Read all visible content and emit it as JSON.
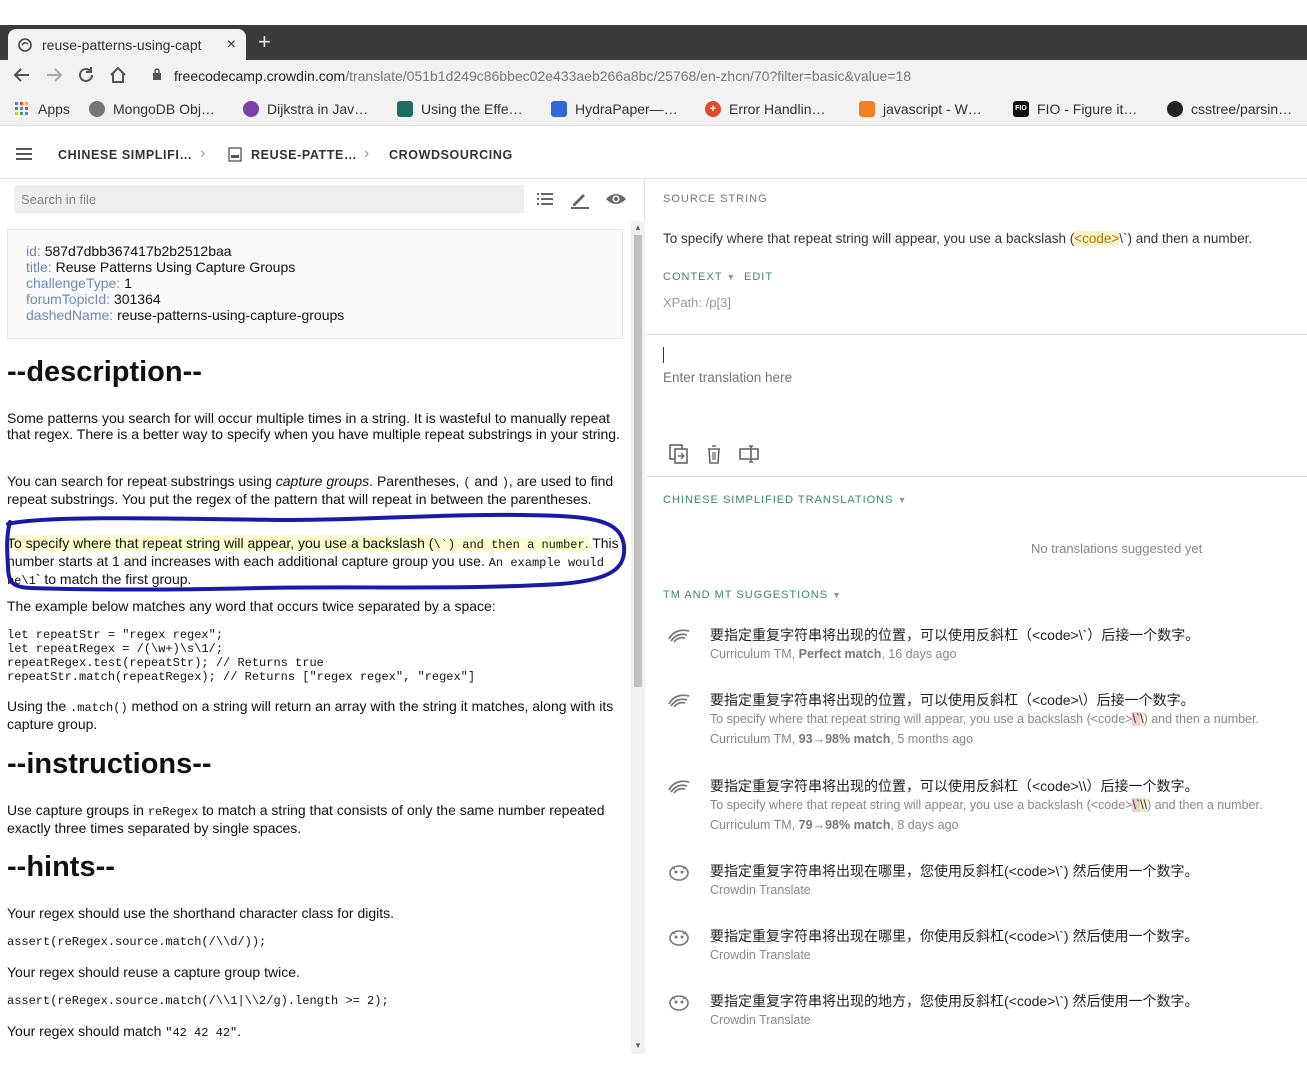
{
  "browser": {
    "tab_title": "reuse-patterns-using-capt",
    "tab_close": "×",
    "new_tab": "+",
    "url_host": "freecodecamp.crowdin.com",
    "url_path": "/translate/051b1d249c86bbec02e433aeb266a8bc/25768/en-zhcn/70?filter=basic&value=18",
    "bookmarks": [
      {
        "label": "Apps",
        "icon": "apps-grid-icon",
        "color": "#4285f4"
      },
      {
        "label": "MongoDB Obj…",
        "icon": "mongodb-icon",
        "color": "#777777"
      },
      {
        "label": "Dijkstra in Jav…",
        "icon": "dijkstra-icon",
        "color": "#7b3fa8"
      },
      {
        "label": "Using the Effe…",
        "icon": "react-icon",
        "color": "#1e6e63"
      },
      {
        "label": "HydraPaper—…",
        "icon": "hydrapaper-icon",
        "color": "#3367d6"
      },
      {
        "label": "Error Handlin…",
        "icon": "error-plus-icon",
        "color": "#e04b29"
      },
      {
        "label": "javascript - W…",
        "icon": "stackoverflow-icon",
        "color": "#f48024"
      },
      {
        "label": "FIO - Figure it…",
        "icon": "fio-icon",
        "color": "#111111"
      },
      {
        "label": "csstree/parsin…",
        "icon": "github-icon",
        "color": "#222222"
      }
    ]
  },
  "header": {
    "breadcrumbs": [
      "CHINESE SIMPLIFI…",
      "REUSE-PATTE…",
      "CROWDSOURCING"
    ]
  },
  "left": {
    "search_placeholder": "Search in file",
    "meta": [
      {
        "k": "id:",
        "v": "587d7dbb367417b2b2512baa"
      },
      {
        "k": "title:",
        "v": "Reuse Patterns Using Capture Groups"
      },
      {
        "k": "challengeType:",
        "v": "1"
      },
      {
        "k": "forumTopicId:",
        "v": "301364"
      },
      {
        "k": "dashedName:",
        "v": "reuse-patterns-using-capture-groups"
      }
    ],
    "h_description": "--description--",
    "p1": "Some patterns you search for will occur multiple times in a string. It is wasteful to manually repeat that regex. There is a better way to specify when you have multiple repeat substrings in your string.",
    "p2_a": "You can search for repeat substrings using ",
    "p2_em": "capture groups",
    "p2_b": ". Parentheses, ",
    "p2_c1": "(",
    "p2_c": " and ",
    "p2_c2": ")",
    "p2_d": ", are used to find repeat substrings. You put the regex of the pattern that will repeat in between the parentheses.",
    "p3_hl": "To specify where that repeat string will appear, you use a backslash (",
    "p3_code1": "\\`) and then a number",
    "p3_dot": ".",
    "p3_rest": " This number starts at 1 and increases with each additional capture group you use. ",
    "p3_code2": "An example would be\\1",
    "p3_end": "` to match the first group.",
    "p4": "The example below matches any word that occurs twice separated by a space:",
    "code_block": "let repeatStr = \"regex regex\";\nlet repeatRegex = /(\\w+)\\s\\1/;\nrepeatRegex.test(repeatStr); // Returns true\nrepeatStr.match(repeatRegex); // Returns [\"regex regex\", \"regex\"]",
    "p5_a": "Using the ",
    "p5_code": ".match()",
    "p5_b": " method on a string will return an array with the string it matches, along with its capture group.",
    "h_instructions": "--instructions--",
    "p6_a": "Use capture groups in ",
    "p6_code": "reRegex",
    "p6_b": " to match a string that consists of only the same number repeated exactly three times separated by single spaces.",
    "h_hints": "--hints--",
    "hint1": "Your regex should use the shorthand character class for digits.",
    "hint1_code": "assert(reRegex.source.match(/\\\\d/));",
    "hint2": "Your regex should reuse a capture group twice.",
    "hint2_code": "assert(reRegex.source.match(/\\\\1|\\\\2/g).length >= 2);",
    "hint3_a": "Your regex should match ",
    "hint3_code": "\"42 42 42\"",
    "hint3_b": "."
  },
  "right": {
    "source_label": "SOURCE STRING",
    "source_a": "To specify where that repeat string will appear, you use a backslash (",
    "source_tag": "<code>",
    "source_b": "\\`) and then a number.",
    "context_label": "CONTEXT",
    "edit_label": "EDIT",
    "xpath": "XPath: /p[3]",
    "translation_placeholder": "Enter translation here",
    "translations_label": "CHINESE SIMPLIFIED TRANSLATIONS",
    "no_translations": "No translations suggested yet",
    "tm_label": "TM AND MT SUGGESTIONS",
    "suggestions": [
      {
        "text": "要指定重复字符串将出现的位置，可以使用反斜杠（<code>\\`）后接一个数字。",
        "meta_a": "Curriculum TM, ",
        "meta_b": "Perfect match",
        "meta_c": ", 16 days ago"
      },
      {
        "text": "要指定重复字符串将出现的位置，可以使用反斜杠（<code>\\）后接一个数字。",
        "src_a": "To specify where that repeat string will appear, you use a backslash (<code>",
        "src_d": "\\`",
        "src_b": "\\",
        "src_c": ") and then a number.",
        "meta_a": "Curriculum TM, ",
        "meta_b": "93→98% match",
        "meta_c": ", 5 months ago"
      },
      {
        "text": "要指定重复字符串将出现的位置，可以使用反斜杠（<code>\\\\）后接一个数字。",
        "src_a": "To specify where that repeat string will appear, you use a backslash (<code>",
        "src_d": "\\`",
        "src_b": "\\\\",
        "src_c": ") and then a number.",
        "meta_a": "Curriculum TM, ",
        "meta_b": "79→98% match",
        "meta_c": ", 8 days ago"
      },
      {
        "text": "要指定重复字符串将出现在哪里，您使用反斜杠(<code>\\`) 然后使用一个数字。",
        "meta_a": "Crowdin Translate"
      },
      {
        "text": "要指定重复字符串将出现在哪里，你使用反斜杠(<code>\\`) 然后使用一个数字。",
        "meta_a": "Crowdin Translate"
      },
      {
        "text": "要指定重复字符串将出现的地方，您使用反斜杠(<code>\\`) 然后使用一个数字。",
        "meta_a": "Crowdin Translate"
      }
    ]
  },
  "colors": {
    "accent_green": "#3b8a5c",
    "annotation_blue": "#1a1aa8",
    "highlight": "#fdfccc"
  }
}
